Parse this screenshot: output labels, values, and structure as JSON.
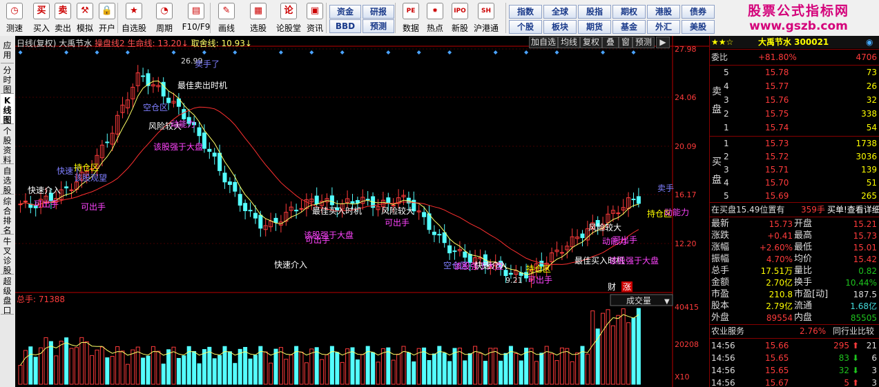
{
  "toolbar": {
    "items": [
      {
        "label": "测速",
        "icon": "clock-icon",
        "glyph": "◷"
      },
      {
        "label": "买入",
        "icon": "buy-icon",
        "glyph": "买"
      },
      {
        "label": "卖出",
        "icon": "sell-icon",
        "glyph": "卖"
      },
      {
        "label": "模拟",
        "icon": "hammer-icon",
        "glyph": "⚒"
      },
      {
        "label": "开户",
        "icon": "lock-icon",
        "glyph": "🔒"
      },
      {
        "label": "自选股",
        "icon": "star-icon",
        "glyph": "★"
      },
      {
        "label": "周期",
        "icon": "period-icon",
        "glyph": "◔"
      },
      {
        "label": "F10/F9",
        "icon": "f10-icon",
        "glyph": "▤"
      },
      {
        "label": "画线",
        "icon": "pen-icon",
        "glyph": "✎"
      },
      {
        "label": "选股",
        "icon": "select-icon",
        "glyph": "▦"
      },
      {
        "label": "论股堂",
        "icon": "forum-icon",
        "glyph": "论"
      },
      {
        "label": "资讯",
        "icon": "news-icon",
        "glyph": "▣"
      }
    ],
    "mid_buttons": [
      "资金",
      "研报",
      "BBD",
      "预测"
    ],
    "items2": [
      {
        "label": "数据",
        "icon": "pe-icon",
        "glyph": "PE"
      },
      {
        "label": "热点",
        "icon": "fire-icon",
        "glyph": "✹"
      },
      {
        "label": "新股",
        "icon": "ipo-icon",
        "glyph": "IPO"
      },
      {
        "label": "沪港通",
        "icon": "hk-icon",
        "glyph": "SH"
      }
    ],
    "market_buttons": [
      [
        "指数",
        "全球",
        "股指",
        "期权",
        "港股",
        "债券"
      ],
      [
        "个股",
        "板块",
        "期货",
        "基金",
        "外汇",
        "美股"
      ]
    ]
  },
  "brand": {
    "line1": "股票公式指标网",
    "line2": "www.gszb.com"
  },
  "left_tabs": [
    "应用",
    "分时图",
    "K线图",
    "个股资料",
    "自选股",
    "综合排名",
    "牛叉诊股",
    "超级盘口"
  ],
  "chart": {
    "header": {
      "period": "日线(复权)",
      "name": "大禹节水",
      "ind1": "操盘线2",
      "ind2": "生命线:",
      "ind2_val": "13.20",
      "ind3": "取舍线:",
      "ind3_val": "10.93"
    },
    "buttons": [
      "加自选",
      "均线",
      "复权",
      "叠",
      "窗",
      "预测"
    ],
    "price_axis": [
      "27.98",
      "24.06",
      "20.09",
      "16.17",
      "12.20"
    ],
    "volume_axis": [
      "40415",
      "20208",
      "X10"
    ],
    "volume_label": "总手: 71388",
    "volume_tab": "成交量",
    "marks": [
      "26.99",
      "9.21"
    ],
    "fin_labels": [
      "财",
      "涨"
    ],
    "annotations": [
      {
        "text": "卖手了",
        "color": "#7f7fff"
      },
      {
        "text": "最佳卖出时机",
        "color": "#ffffff"
      },
      {
        "text": "空仓区",
        "color": "#7f7fff"
      },
      {
        "text": "风险较大",
        "color": "#ffffff"
      },
      {
        "text": "动能力",
        "color": "#ff44ff"
      },
      {
        "text": "该股强于大盘",
        "color": "#ff44ff"
      },
      {
        "text": "快速下",
        "color": "#7f7fff"
      },
      {
        "text": "持仓区",
        "color": "#ffff00"
      },
      {
        "text": "该股观望",
        "color": "#7f7fff"
      },
      {
        "text": "快速介入",
        "color": "#ffffff"
      },
      {
        "text": "可出手",
        "color": "#ff44ff"
      },
      {
        "text": "可出手",
        "color": "#ff44ff"
      },
      {
        "text": "快速介入",
        "color": "#ffffff"
      },
      {
        "text": "最佳买入时机",
        "color": "#ffffff"
      },
      {
        "text": "风险较大",
        "color": "#ffffff"
      },
      {
        "text": "动能力",
        "color": "#ff44ff"
      },
      {
        "text": "可出手",
        "color": "#ff44ff"
      },
      {
        "text": "该股强于大盘",
        "color": "#ff44ff"
      },
      {
        "text": "可出手",
        "color": "#ff44ff"
      },
      {
        "text": "空仓区",
        "color": "#7f7fff"
      },
      {
        "text": "该股强于大盘",
        "color": "#ff44ff"
      },
      {
        "text": "快速介入",
        "color": "#ffffff"
      },
      {
        "text": "持仓区",
        "color": "#ffff00"
      },
      {
        "text": "可出手",
        "color": "#ff44ff"
      },
      {
        "text": "最佳买入时机",
        "color": "#ffffff"
      },
      {
        "text": "该股强于大盘",
        "color": "#ff44ff"
      },
      {
        "text": "风险较大",
        "color": "#ffffff"
      },
      {
        "text": "可出手",
        "color": "#ff44ff"
      },
      {
        "text": "卖手",
        "color": "#7f7fff"
      },
      {
        "text": "持仓区",
        "color": "#ffff00"
      },
      {
        "text": "动能力",
        "color": "#ff44ff"
      }
    ]
  },
  "quote": {
    "title": "大禹节水 300021",
    "webi": {
      "label": "委比",
      "pct": "+81.80%",
      "diff": "4706"
    },
    "sell_label": "卖盘",
    "buy_label": "买盘",
    "sells": [
      [
        "5",
        "15.78",
        "73"
      ],
      [
        "4",
        "15.77",
        "26"
      ],
      [
        "3",
        "15.76",
        "32"
      ],
      [
        "2",
        "15.75",
        "338"
      ],
      [
        "1",
        "15.74",
        "54"
      ]
    ],
    "buys": [
      [
        "1",
        "15.73",
        "1738"
      ],
      [
        "2",
        "15.72",
        "3036"
      ],
      [
        "3",
        "15.71",
        "139"
      ],
      [
        "4",
        "15.70",
        "51"
      ],
      [
        "5",
        "15.69",
        "265"
      ]
    ],
    "order_info": "在买盘15.49位置有",
    "order_qty": "359手",
    "order_link": "买单!查看详细",
    "stats": [
      [
        "最新",
        "15.73",
        "开盘",
        "15.21"
      ],
      [
        "涨跌",
        "+0.41",
        "最高",
        "15.73"
      ],
      [
        "涨幅",
        "+2.60%",
        "最低",
        "15.01"
      ],
      [
        "振幅",
        "4.70%",
        "均价",
        "15.42"
      ],
      [
        "总手",
        "17.51万",
        "量比",
        "0.82"
      ],
      [
        "金额",
        "2.70亿",
        "换手",
        "10.44%"
      ],
      [
        "市盈",
        "210.8",
        "市盈[动]",
        "187.5"
      ],
      [
        "股本",
        "2.79亿",
        "流通",
        "1.68亿"
      ],
      [
        "外盘",
        "89554",
        "内盘",
        "85505"
      ]
    ],
    "sector": {
      "name": "农业服务",
      "pct": "2.76%",
      "link": "同行业比较"
    },
    "ticks": [
      [
        "14:56",
        "15.66",
        "295",
        "21"
      ],
      [
        "14:56",
        "15.65",
        "83",
        "6"
      ],
      [
        "14:56",
        "15.65",
        "32",
        "3"
      ],
      [
        "14:56",
        "15.67",
        "5",
        "3"
      ]
    ]
  },
  "colors": {
    "up": "#ff3b3b",
    "down": "#54ffff",
    "bg": "#000000",
    "brand": "#d4007a"
  }
}
